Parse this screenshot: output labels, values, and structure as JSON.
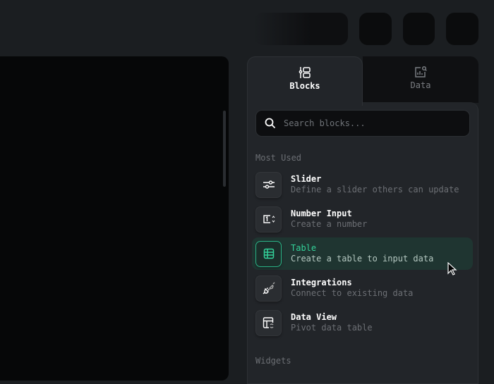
{
  "tabs": [
    {
      "label": "Blocks",
      "icon": "blocks-icon",
      "active": true
    },
    {
      "label": "Data",
      "icon": "data-search-icon",
      "active": false
    }
  ],
  "search": {
    "placeholder": "Search blocks..."
  },
  "sections": {
    "most_used": "Most Used",
    "widgets": "Widgets"
  },
  "items": [
    {
      "title": "Slider",
      "desc": "Define a slider others can update",
      "icon": "slider-icon"
    },
    {
      "title": "Number Input",
      "desc": "Create a number",
      "icon": "number-input-icon"
    },
    {
      "title": "Table",
      "desc": "Create a table to input data",
      "icon": "table-icon",
      "highlighted": true
    },
    {
      "title": "Integrations",
      "desc": "Connect to existing data",
      "icon": "plug-icon"
    },
    {
      "title": "Data View",
      "desc": "Pivot data table",
      "icon": "pivot-table-icon"
    }
  ],
  "colors": {
    "accent": "#33d199",
    "background": "#1b1e21",
    "panel": "#222529"
  }
}
